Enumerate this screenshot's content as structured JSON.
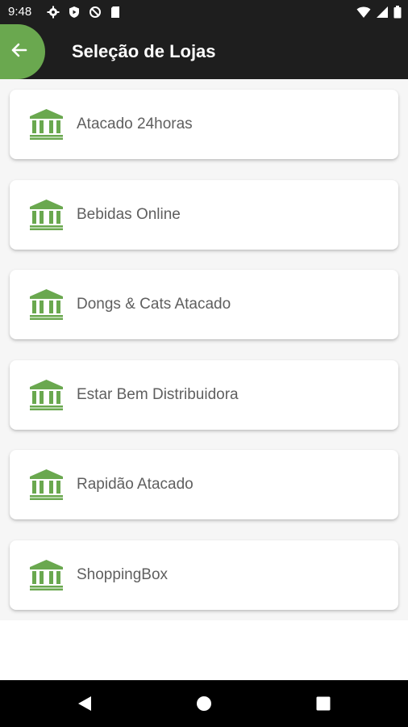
{
  "status_bar": {
    "time": "9:48",
    "left_icons": [
      "gear-icon",
      "shield-play-icon",
      "no-sync-icon",
      "sd-card-icon"
    ],
    "right_icons": [
      "wifi-icon",
      "signal-icon",
      "battery-icon"
    ]
  },
  "app_bar": {
    "title": "Seleção de Lojas",
    "back_icon": "arrow-left-icon"
  },
  "stores": [
    {
      "name": "Atacado 24horas",
      "icon": "bank-icon"
    },
    {
      "name": "Bebidas Online",
      "icon": "bank-icon"
    },
    {
      "name": "Dongs & Cats Atacado",
      "icon": "bank-icon"
    },
    {
      "name": "Estar Bem Distribuidora",
      "icon": "bank-icon"
    },
    {
      "name": "Rapidão Atacado",
      "icon": "bank-icon"
    },
    {
      "name": "ShoppingBox",
      "icon": "bank-icon"
    }
  ],
  "nav_bar": {
    "buttons": [
      "back-triangle-icon",
      "home-circle-icon",
      "recents-square-icon"
    ]
  },
  "colors": {
    "accent": "#6aa84f",
    "app_bar": "#1e1e1e",
    "card_text": "#5f5f5f",
    "list_background": "#f6f6f6"
  }
}
